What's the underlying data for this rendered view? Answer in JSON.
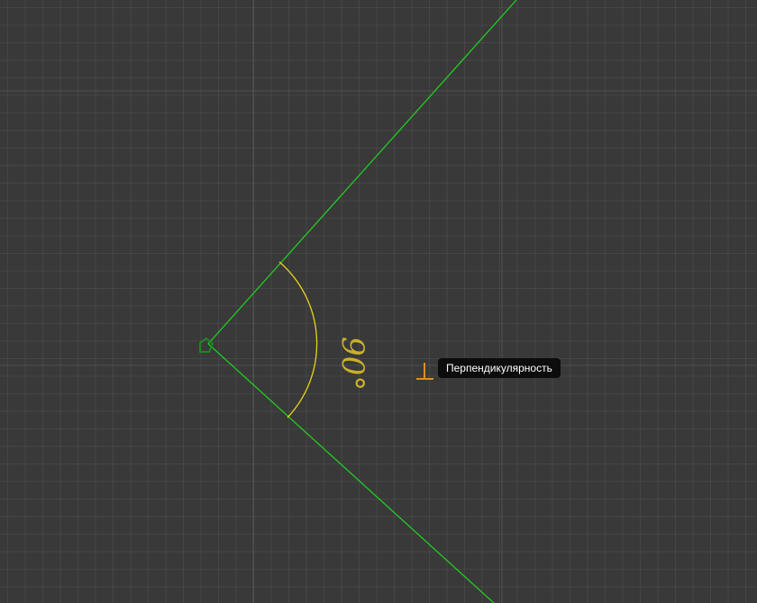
{
  "viewport": {
    "angle_value_label": "90°",
    "perpendicular_glyph": "⊥",
    "tooltip_text": "Перпендикулярность"
  },
  "colors": {
    "background": "#393939",
    "line": "#22cc22",
    "angle_arc": "#e8d21a",
    "angle_label": "#c9b12a",
    "constraint_icon": "#d9901e",
    "vertex_marker": "#1a8f1a",
    "tooltip_bg": "#0c0c0c",
    "tooltip_text": "#ffffff"
  }
}
